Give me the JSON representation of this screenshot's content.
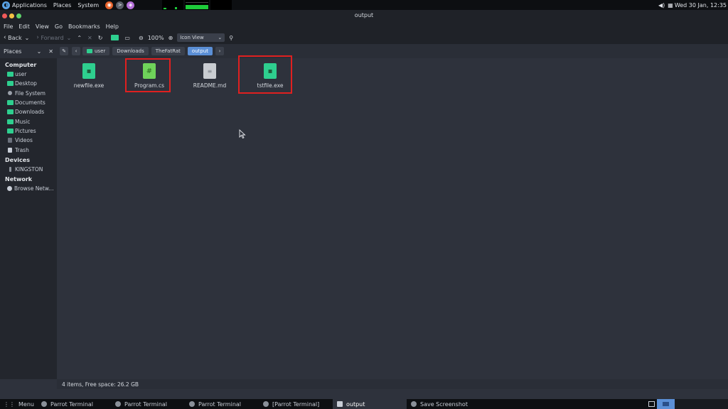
{
  "top_panel": {
    "menu": [
      "Applications",
      "Places",
      "System"
    ],
    "clock": "Wed 30 Jan, 12:35",
    "launchers": [
      "firefox-icon",
      "terminal-icon",
      "app-icon"
    ]
  },
  "window": {
    "title": "output",
    "menubar": [
      "File",
      "Edit",
      "View",
      "Go",
      "Bookmarks",
      "Help"
    ],
    "toolbar": {
      "back_label": "Back",
      "forward_label": "Forward",
      "zoom_level": "100%",
      "view_mode": "Icon View"
    },
    "location": {
      "places_label": "Places",
      "breadcrumbs": [
        "user",
        "Downloads",
        "TheFatRat",
        "output"
      ]
    },
    "sidebar": {
      "sections": [
        {
          "title": "Computer",
          "items": [
            "user",
            "Desktop",
            "File System",
            "Documents",
            "Downloads",
            "Music",
            "Pictures",
            "Videos",
            "Trash"
          ]
        },
        {
          "title": "Devices",
          "items": [
            "KINGSTON"
          ]
        },
        {
          "title": "Network",
          "items": [
            "Browse Netw..."
          ]
        }
      ]
    },
    "files": [
      {
        "name": "newfile.exe",
        "icon": "executable-icon",
        "color": "#2ecf8f"
      },
      {
        "name": "Program.cs",
        "icon": "csharp-file-icon",
        "color": "#6fd35a"
      },
      {
        "name": "README.md",
        "icon": "text-file-icon",
        "color": "#c9ccd1"
      },
      {
        "name": "tstfile.exe",
        "icon": "executable-icon",
        "color": "#2ecf8f"
      }
    ],
    "status": "4 items, Free space: 26.2 GB"
  },
  "taskbar": {
    "menu_label": "Menu",
    "tasks": [
      "Parrot Terminal",
      "Parrot Terminal",
      "Parrot Terminal",
      "[Parrot Terminal]",
      "output",
      "Save Screenshot"
    ]
  },
  "colors": {
    "accent": "#5b8fd6",
    "highlight_box": "#e02020",
    "monitor_green": "#1ecb3a"
  }
}
